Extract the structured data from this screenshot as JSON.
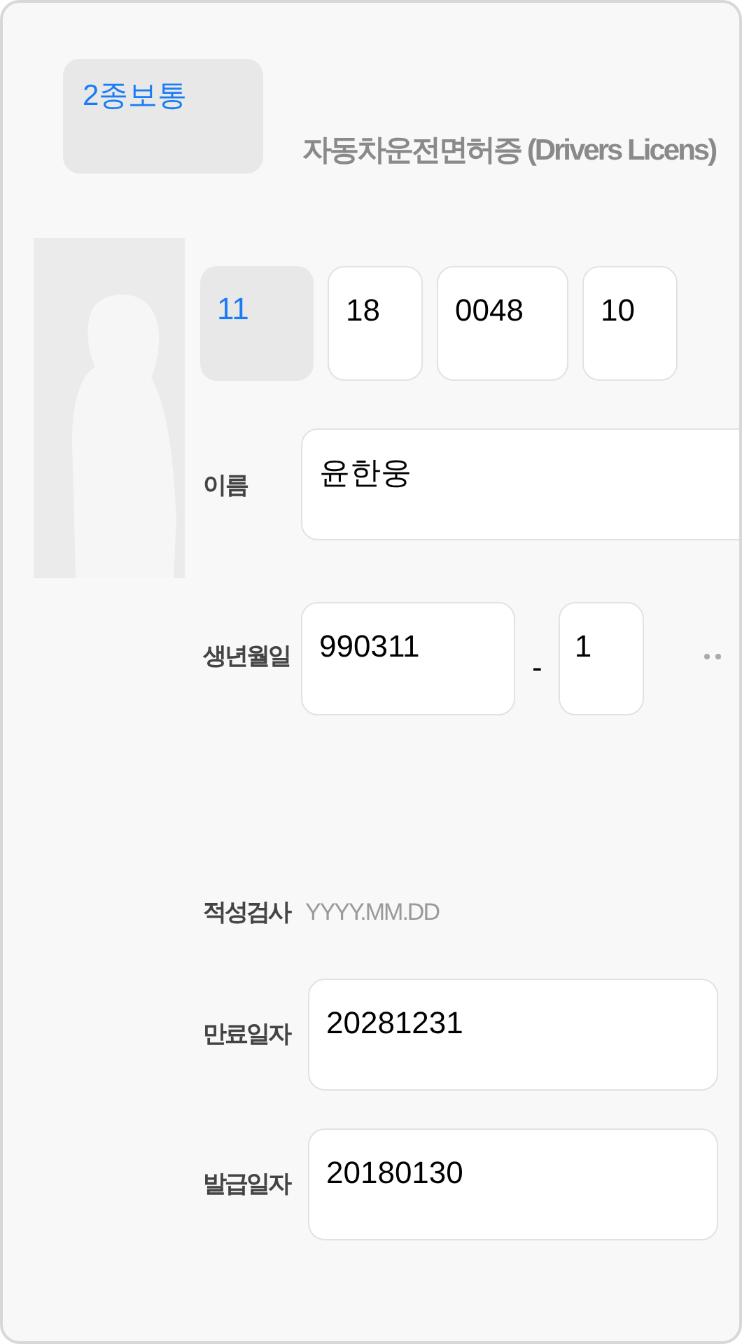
{
  "license_type": {
    "value": "2종보통",
    "kind": "picker"
  },
  "title": "자동차운전면허증 (Drivers Licens)",
  "license_number": [
    {
      "value": "11",
      "kind": "picker"
    },
    {
      "value": "18",
      "kind": "text"
    },
    {
      "value": "0048",
      "kind": "text"
    },
    {
      "value": "10",
      "kind": "text"
    }
  ],
  "name": {
    "label": "이름",
    "value": "윤한웅"
  },
  "birth": {
    "label": "생년월일",
    "value": "990311",
    "separator": "-",
    "gender_digit": "1"
  },
  "aptitude_test": {
    "label": "적성검사",
    "placeholder": "YYYY.MM.DD"
  },
  "dates": [
    {
      "label": "만료일자",
      "value": "20281231"
    },
    {
      "label": "발급일자",
      "value": "20180130"
    }
  ]
}
